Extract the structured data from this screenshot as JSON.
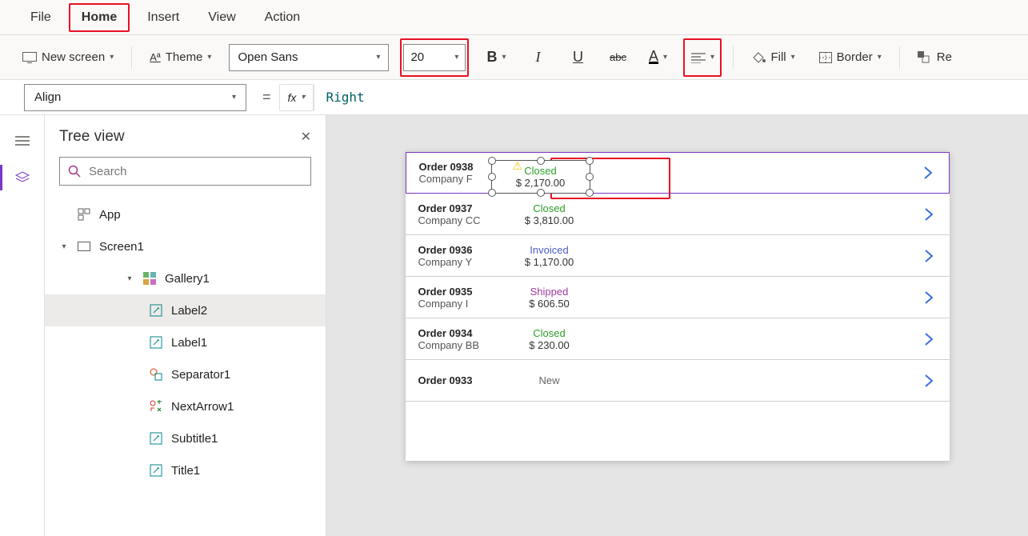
{
  "menu": {
    "items": [
      "File",
      "Home",
      "Insert",
      "View",
      "Action"
    ],
    "active": "Home"
  },
  "toolbar": {
    "new_screen": "New screen",
    "theme": "Theme",
    "font_name": "Open Sans",
    "font_size": "20",
    "bold": "B",
    "fill": "Fill",
    "border": "Border",
    "re": "Re"
  },
  "formula": {
    "property": "Align",
    "fx": "fx",
    "value": "Right"
  },
  "tree": {
    "title": "Tree view",
    "search_placeholder": "Search",
    "nodes": {
      "app": "App",
      "screen1": "Screen1",
      "gallery1": "Gallery1",
      "label2": "Label2",
      "label1": "Label1",
      "separator1": "Separator1",
      "nextarrow1": "NextArrow1",
      "subtitle1": "Subtitle1",
      "title1": "Title1"
    }
  },
  "gallery": [
    {
      "order": "Order 0938",
      "company": "Company F",
      "status": "Closed",
      "status_cls": "closed",
      "price": "$ 2,170.00"
    },
    {
      "order": "Order 0937",
      "company": "Company CC",
      "status": "Closed",
      "status_cls": "closed",
      "price": "$ 3,810.00"
    },
    {
      "order": "Order 0936",
      "company": "Company Y",
      "status": "Invoiced",
      "status_cls": "invoiced",
      "price": "$ 1,170.00"
    },
    {
      "order": "Order 0935",
      "company": "Company I",
      "status": "Shipped",
      "status_cls": "shipped",
      "price": "$ 606.50"
    },
    {
      "order": "Order 0934",
      "company": "Company BB",
      "status": "Closed",
      "status_cls": "closed",
      "price": "$ 230.00"
    },
    {
      "order": "Order 0933",
      "company": "",
      "status": "New",
      "status_cls": "new",
      "price": ""
    }
  ]
}
